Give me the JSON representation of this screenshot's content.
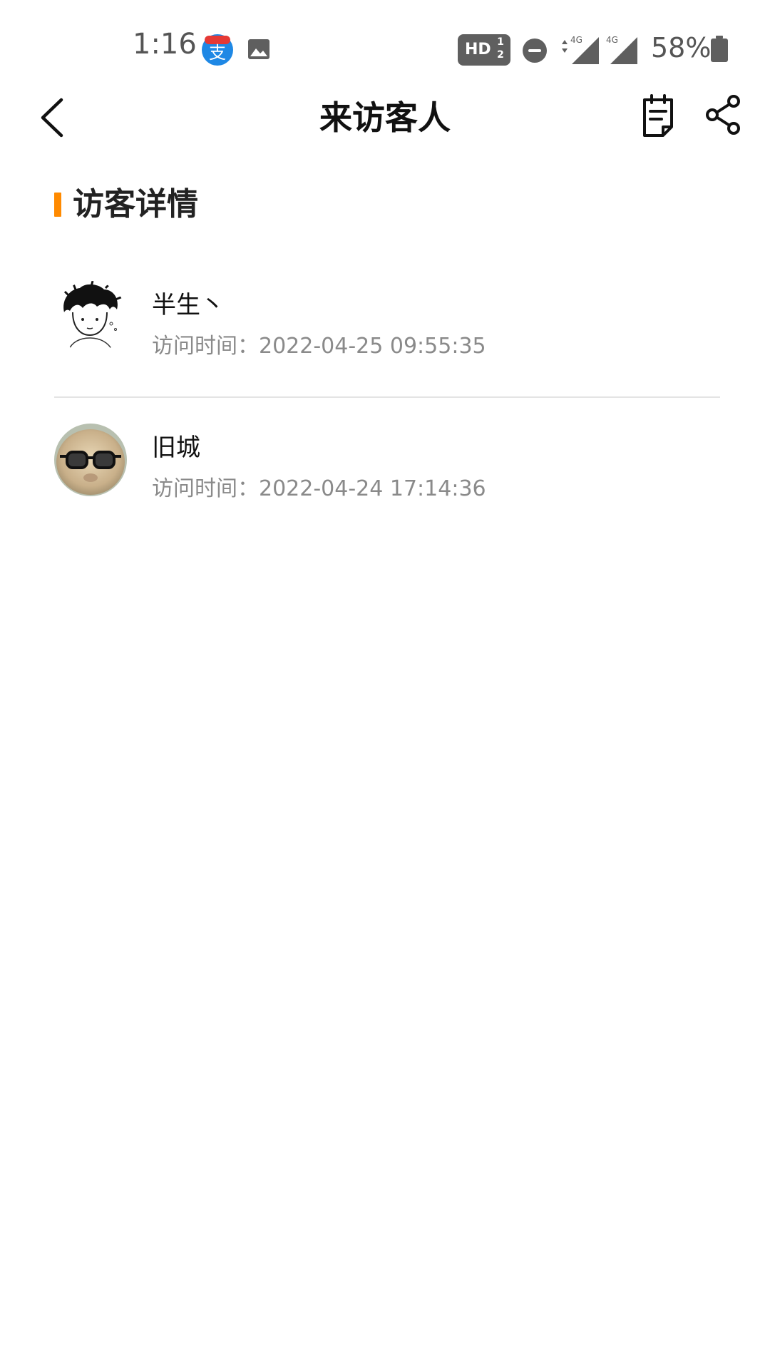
{
  "status_bar": {
    "time": "1:16",
    "hd_label": "HD",
    "hd_fraction_top": "1",
    "hd_fraction_bottom": "2",
    "network_1": "4G",
    "network_2": "4G",
    "battery": "58%",
    "icons": [
      "alipay-icon",
      "gallery-icon",
      "hd-voice-icon",
      "dnd-icon",
      "signal-icon",
      "battery-icon"
    ]
  },
  "header": {
    "title": "来访客人",
    "back_icon": "chevron-left-icon",
    "notes_icon": "notes-icon",
    "share_icon": "share-icon"
  },
  "section": {
    "title": "访客详情",
    "accent_color": "#ff8a00"
  },
  "visitors": [
    {
      "name": "半生丶",
      "time": "访问时间：2022-04-25 09:55:35",
      "avatar": "sketch-boy-avatar"
    },
    {
      "name": "旧城",
      "time": "访问时间：2022-04-24 17:14:36",
      "avatar": "glasses-avatar"
    }
  ]
}
